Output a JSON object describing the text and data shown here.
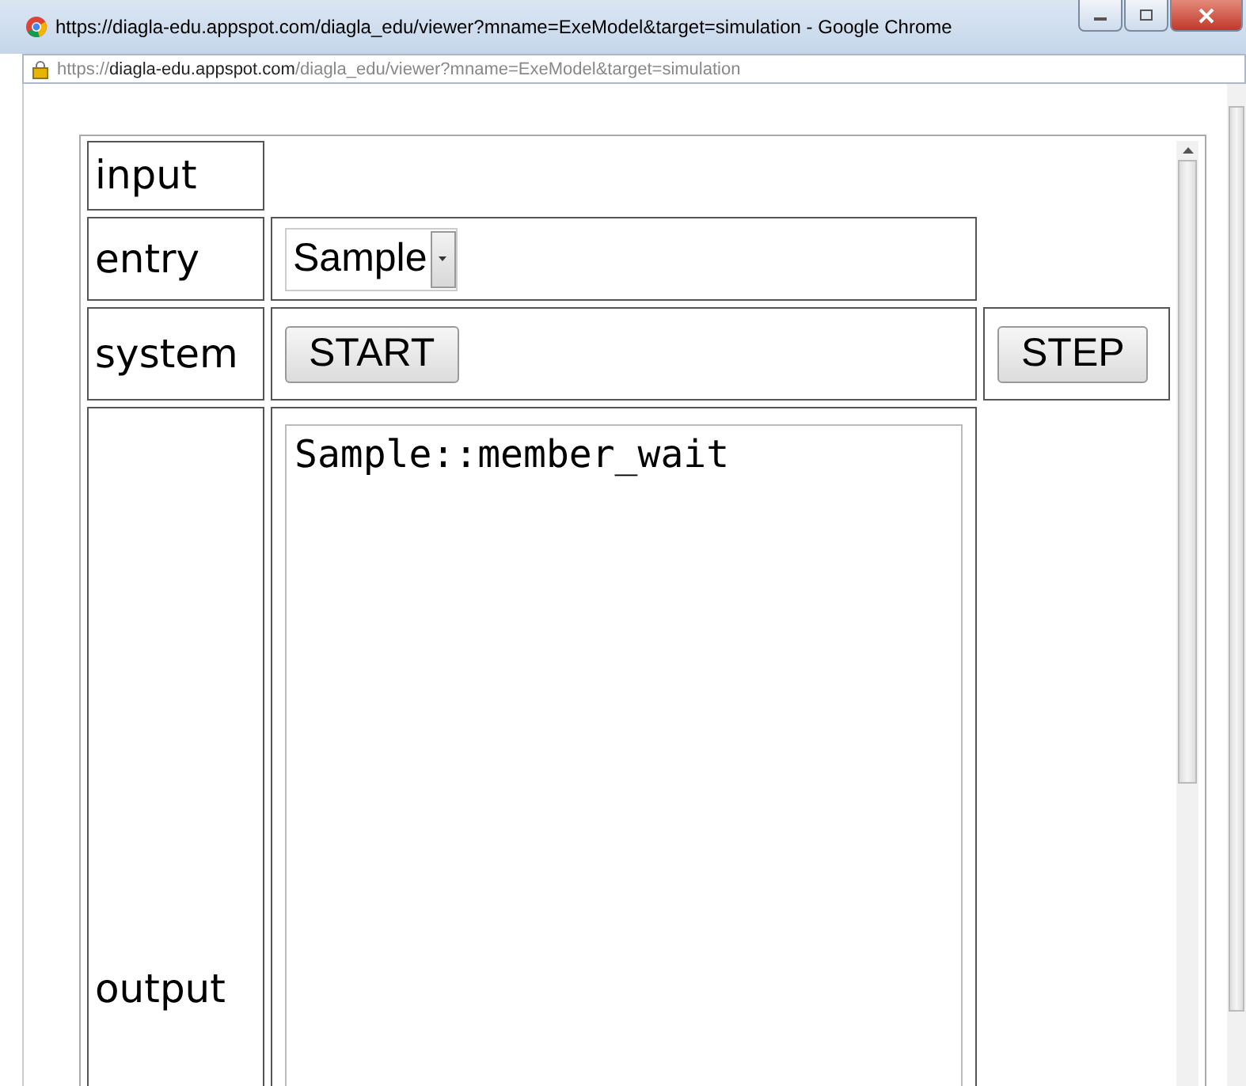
{
  "window": {
    "title": "https://diagla-edu.appspot.com/diagla_edu/viewer?mname=ExeModel&target=simulation - Google Chrome"
  },
  "address_bar": {
    "scheme": "https://",
    "host": "diagla-edu.appspot.com",
    "path": "/diagla_edu/viewer?mname=ExeModel&target=simulation"
  },
  "form": {
    "heading": "input",
    "entry": {
      "label": "entry",
      "value": "Sample"
    },
    "system": {
      "label": "system",
      "buttons": [
        "START",
        "STEP"
      ]
    },
    "output": {
      "label": "output",
      "value": "Sample::member_wait"
    }
  }
}
